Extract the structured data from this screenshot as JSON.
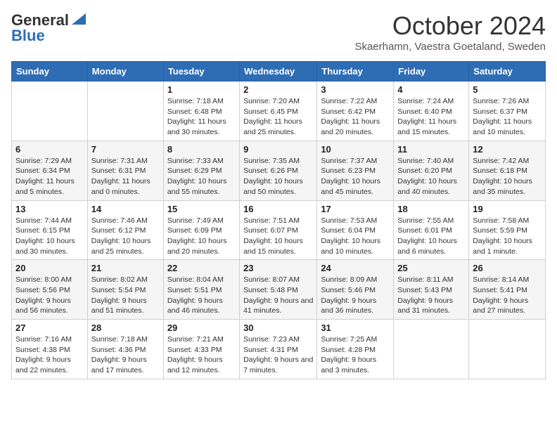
{
  "logo": {
    "general": "General",
    "blue": "Blue"
  },
  "title": "October 2024",
  "subtitle": "Skaerhamn, Vaestra Goetaland, Sweden",
  "days_of_week": [
    "Sunday",
    "Monday",
    "Tuesday",
    "Wednesday",
    "Thursday",
    "Friday",
    "Saturday"
  ],
  "weeks": [
    [
      {
        "day": "",
        "sunrise": "",
        "sunset": "",
        "daylight": ""
      },
      {
        "day": "",
        "sunrise": "",
        "sunset": "",
        "daylight": ""
      },
      {
        "day": "1",
        "sunrise": "Sunrise: 7:18 AM",
        "sunset": "Sunset: 6:48 PM",
        "daylight": "Daylight: 11 hours and 30 minutes."
      },
      {
        "day": "2",
        "sunrise": "Sunrise: 7:20 AM",
        "sunset": "Sunset: 6:45 PM",
        "daylight": "Daylight: 11 hours and 25 minutes."
      },
      {
        "day": "3",
        "sunrise": "Sunrise: 7:22 AM",
        "sunset": "Sunset: 6:42 PM",
        "daylight": "Daylight: 11 hours and 20 minutes."
      },
      {
        "day": "4",
        "sunrise": "Sunrise: 7:24 AM",
        "sunset": "Sunset: 6:40 PM",
        "daylight": "Daylight: 11 hours and 15 minutes."
      },
      {
        "day": "5",
        "sunrise": "Sunrise: 7:26 AM",
        "sunset": "Sunset: 6:37 PM",
        "daylight": "Daylight: 11 hours and 10 minutes."
      }
    ],
    [
      {
        "day": "6",
        "sunrise": "Sunrise: 7:29 AM",
        "sunset": "Sunset: 6:34 PM",
        "daylight": "Daylight: 11 hours and 5 minutes."
      },
      {
        "day": "7",
        "sunrise": "Sunrise: 7:31 AM",
        "sunset": "Sunset: 6:31 PM",
        "daylight": "Daylight: 11 hours and 0 minutes."
      },
      {
        "day": "8",
        "sunrise": "Sunrise: 7:33 AM",
        "sunset": "Sunset: 6:29 PM",
        "daylight": "Daylight: 10 hours and 55 minutes."
      },
      {
        "day": "9",
        "sunrise": "Sunrise: 7:35 AM",
        "sunset": "Sunset: 6:26 PM",
        "daylight": "Daylight: 10 hours and 50 minutes."
      },
      {
        "day": "10",
        "sunrise": "Sunrise: 7:37 AM",
        "sunset": "Sunset: 6:23 PM",
        "daylight": "Daylight: 10 hours and 45 minutes."
      },
      {
        "day": "11",
        "sunrise": "Sunrise: 7:40 AM",
        "sunset": "Sunset: 6:20 PM",
        "daylight": "Daylight: 10 hours and 40 minutes."
      },
      {
        "day": "12",
        "sunrise": "Sunrise: 7:42 AM",
        "sunset": "Sunset: 6:18 PM",
        "daylight": "Daylight: 10 hours and 35 minutes."
      }
    ],
    [
      {
        "day": "13",
        "sunrise": "Sunrise: 7:44 AM",
        "sunset": "Sunset: 6:15 PM",
        "daylight": "Daylight: 10 hours and 30 minutes."
      },
      {
        "day": "14",
        "sunrise": "Sunrise: 7:46 AM",
        "sunset": "Sunset: 6:12 PM",
        "daylight": "Daylight: 10 hours and 25 minutes."
      },
      {
        "day": "15",
        "sunrise": "Sunrise: 7:49 AM",
        "sunset": "Sunset: 6:09 PM",
        "daylight": "Daylight: 10 hours and 20 minutes."
      },
      {
        "day": "16",
        "sunrise": "Sunrise: 7:51 AM",
        "sunset": "Sunset: 6:07 PM",
        "daylight": "Daylight: 10 hours and 15 minutes."
      },
      {
        "day": "17",
        "sunrise": "Sunrise: 7:53 AM",
        "sunset": "Sunset: 6:04 PM",
        "daylight": "Daylight: 10 hours and 10 minutes."
      },
      {
        "day": "18",
        "sunrise": "Sunrise: 7:55 AM",
        "sunset": "Sunset: 6:01 PM",
        "daylight": "Daylight: 10 hours and 6 minutes."
      },
      {
        "day": "19",
        "sunrise": "Sunrise: 7:58 AM",
        "sunset": "Sunset: 5:59 PM",
        "daylight": "Daylight: 10 hours and 1 minute."
      }
    ],
    [
      {
        "day": "20",
        "sunrise": "Sunrise: 8:00 AM",
        "sunset": "Sunset: 5:56 PM",
        "daylight": "Daylight: 9 hours and 56 minutes."
      },
      {
        "day": "21",
        "sunrise": "Sunrise: 8:02 AM",
        "sunset": "Sunset: 5:54 PM",
        "daylight": "Daylight: 9 hours and 51 minutes."
      },
      {
        "day": "22",
        "sunrise": "Sunrise: 8:04 AM",
        "sunset": "Sunset: 5:51 PM",
        "daylight": "Daylight: 9 hours and 46 minutes."
      },
      {
        "day": "23",
        "sunrise": "Sunrise: 8:07 AM",
        "sunset": "Sunset: 5:48 PM",
        "daylight": "Daylight: 9 hours and 41 minutes."
      },
      {
        "day": "24",
        "sunrise": "Sunrise: 8:09 AM",
        "sunset": "Sunset: 5:46 PM",
        "daylight": "Daylight: 9 hours and 36 minutes."
      },
      {
        "day": "25",
        "sunrise": "Sunrise: 8:11 AM",
        "sunset": "Sunset: 5:43 PM",
        "daylight": "Daylight: 9 hours and 31 minutes."
      },
      {
        "day": "26",
        "sunrise": "Sunrise: 8:14 AM",
        "sunset": "Sunset: 5:41 PM",
        "daylight": "Daylight: 9 hours and 27 minutes."
      }
    ],
    [
      {
        "day": "27",
        "sunrise": "Sunrise: 7:16 AM",
        "sunset": "Sunset: 4:38 PM",
        "daylight": "Daylight: 9 hours and 22 minutes."
      },
      {
        "day": "28",
        "sunrise": "Sunrise: 7:18 AM",
        "sunset": "Sunset: 4:36 PM",
        "daylight": "Daylight: 9 hours and 17 minutes."
      },
      {
        "day": "29",
        "sunrise": "Sunrise: 7:21 AM",
        "sunset": "Sunset: 4:33 PM",
        "daylight": "Daylight: 9 hours and 12 minutes."
      },
      {
        "day": "30",
        "sunrise": "Sunrise: 7:23 AM",
        "sunset": "Sunset: 4:31 PM",
        "daylight": "Daylight: 9 hours and 7 minutes."
      },
      {
        "day": "31",
        "sunrise": "Sunrise: 7:25 AM",
        "sunset": "Sunset: 4:28 PM",
        "daylight": "Daylight: 9 hours and 3 minutes."
      },
      {
        "day": "",
        "sunrise": "",
        "sunset": "",
        "daylight": ""
      },
      {
        "day": "",
        "sunrise": "",
        "sunset": "",
        "daylight": ""
      }
    ]
  ]
}
